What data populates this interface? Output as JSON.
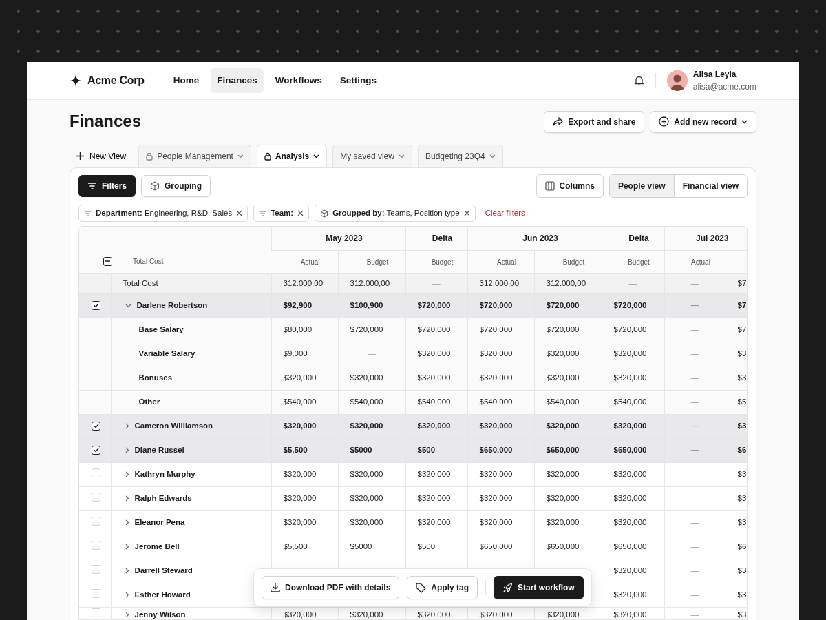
{
  "nav": {
    "brand": "Acme Corp",
    "items": [
      {
        "label": "Home",
        "selected": false
      },
      {
        "label": "Finances",
        "selected": true
      },
      {
        "label": "Workflows",
        "selected": false
      },
      {
        "label": "Settings",
        "selected": false
      }
    ],
    "user": {
      "name": "Alisa Leyla",
      "email": "alisa@acme.com"
    }
  },
  "page": {
    "title": "Finances",
    "actions": [
      {
        "label": "Export and share",
        "kind": "share"
      },
      {
        "label": "Add new record",
        "kind": "add"
      }
    ]
  },
  "views": {
    "new_view": "New View",
    "tabs": [
      {
        "label": "People Management",
        "locked": true,
        "selected": false
      },
      {
        "label": "Analysis",
        "locked": true,
        "selected": true
      },
      {
        "label": "My saved view",
        "locked": false,
        "selected": false
      },
      {
        "label": "Budgeting 23Q4",
        "locked": false,
        "selected": false
      }
    ]
  },
  "toolbar": {
    "filters": {
      "label": "Filters",
      "active": true
    },
    "grouping": {
      "label": "Grouping",
      "active": false
    },
    "columns": "Columns",
    "view_toggle": [
      {
        "label": "People view",
        "selected": true
      },
      {
        "label": "Financial view",
        "selected": false
      }
    ]
  },
  "chips": [
    {
      "kind": "filter",
      "text": "**Department:** Engineering, R&D, Sales"
    },
    {
      "kind": "filter",
      "text": "**Team:**"
    },
    {
      "kind": "group",
      "text": "**Groupped by:** Teams, Position type"
    }
  ],
  "clear_filters": "Clear filters",
  "table": {
    "header_label": "Total Cost",
    "header_indeterminate": true,
    "groups": [
      {
        "label": "May 2023",
        "columns": [
          "Actual",
          "Budget"
        ]
      },
      {
        "label": "Delta",
        "columns": [
          "Budget"
        ]
      },
      {
        "label": "Jun 2023",
        "columns": [
          "Actual",
          "Budget"
        ]
      },
      {
        "label": "Delta",
        "columns": [
          "Budget"
        ]
      },
      {
        "label": "Jul 2023",
        "columns": [
          "Actual"
        ]
      }
    ],
    "total": {
      "label": "Total Cost",
      "values": [
        "312.000,00",
        "312.000,00",
        "—",
        "312.000,00",
        "312.000,00",
        "—",
        "—",
        "$7"
      ]
    },
    "rows": [
      {
        "name": "Darlene Robertson",
        "checked": true,
        "expanded": true,
        "values": [
          "$92,900",
          "$100,900",
          "$720,000",
          "$720,000",
          "$720,000",
          "$720,000",
          "—",
          "$7"
        ],
        "children": [
          {
            "name": "Base Salary",
            "values": [
              "$80,000",
              "$720,000",
              "$720,000",
              "$720,000",
              "$720,000",
              "$720,000",
              "—",
              "$7"
            ]
          },
          {
            "name": "Variable Salary",
            "values": [
              "$9,000",
              "—",
              "$320,000",
              "$320,000",
              "$320,000",
              "$320,000",
              "—",
              "$3"
            ]
          },
          {
            "name": "Bonuses",
            "values": [
              "$320,000",
              "$320,000",
              "$320,000",
              "$320,000",
              "$320,000",
              "$320,000",
              "—",
              "$3"
            ]
          },
          {
            "name": "Other",
            "values": [
              "$540,000",
              "$540,000",
              "$540,000",
              "$540,000",
              "$540,000",
              "$540,000",
              "—",
              "$5"
            ]
          }
        ]
      },
      {
        "name": "Cameron Williamson",
        "checked": true,
        "expanded": false,
        "values": [
          "$320,000",
          "$320,000",
          "$320,000",
          "$320,000",
          "$320,000",
          "$320,000",
          "—",
          "$3"
        ]
      },
      {
        "name": "Diane Russel",
        "checked": true,
        "expanded": false,
        "values": [
          "$5,500",
          "$5000",
          "$500",
          "$650,000",
          "$650,000",
          "$650,000",
          "—",
          "$6"
        ]
      },
      {
        "name": "Kathryn Murphy",
        "checked": false,
        "expanded": false,
        "values": [
          "$320,000",
          "$320,000",
          "$320,000",
          "$320,000",
          "$320,000",
          "$320,000",
          "—",
          "$3"
        ]
      },
      {
        "name": "Ralph Edwards",
        "checked": false,
        "expanded": false,
        "values": [
          "$320,000",
          "$320,000",
          "$320,000",
          "$320,000",
          "$320,000",
          "$320,000",
          "—",
          "$3"
        ]
      },
      {
        "name": "Eleanor Pena",
        "checked": false,
        "expanded": false,
        "values": [
          "$320,000",
          "$320,000",
          "$320,000",
          "$320,000",
          "$320,000",
          "$320,000",
          "—",
          "$3"
        ]
      },
      {
        "name": "Jerome Bell",
        "checked": false,
        "expanded": false,
        "values": [
          "$5,500",
          "$5000",
          "$500",
          "$650,000",
          "$650,000",
          "$650,000",
          "—",
          "$6"
        ]
      },
      {
        "name": "Darrell Steward",
        "checked": false,
        "expanded": false,
        "values": [
          "$320,000",
          "—",
          "$3"
        ]
      },
      {
        "name": "Esther Howard",
        "checked": false,
        "expanded": false,
        "values": [
          "$320,000",
          "—",
          "$3"
        ]
      },
      {
        "name": "Jenny Wilson",
        "checked": false,
        "expanded": false,
        "values": [
          "$320,000",
          "$320,000",
          "$320,000",
          "$320,000",
          "$320,000",
          "$320,000",
          "—",
          "$3"
        ]
      }
    ]
  },
  "action_bar": [
    {
      "label": "Download PDF with details",
      "kind": "secondary"
    },
    {
      "label": "Apply tag",
      "kind": "secondary"
    },
    {
      "label": "Start workflow",
      "kind": "primary"
    }
  ]
}
